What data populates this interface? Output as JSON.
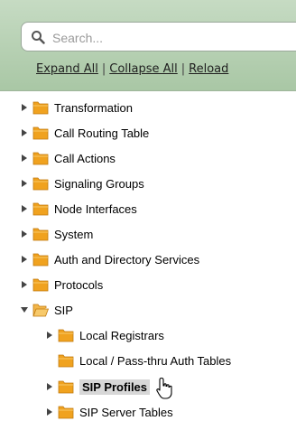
{
  "search": {
    "placeholder": "Search..."
  },
  "links": {
    "expand_all": "Expand All",
    "collapse_all": "Collapse All",
    "reload": "Reload",
    "separator": "|"
  },
  "tree": {
    "items": [
      {
        "label": "Transformation",
        "expanded": false
      },
      {
        "label": "Call Routing Table",
        "expanded": false
      },
      {
        "label": "Call Actions",
        "expanded": false
      },
      {
        "label": "Signaling Groups",
        "expanded": false
      },
      {
        "label": "Node Interfaces",
        "expanded": false
      },
      {
        "label": "System",
        "expanded": false
      },
      {
        "label": "Auth and Directory Services",
        "expanded": false
      },
      {
        "label": "Protocols",
        "expanded": false
      },
      {
        "label": "SIP",
        "expanded": true,
        "children": [
          {
            "label": "Local Registrars",
            "expanded": false
          },
          {
            "label": "Local / Pass-thru Auth Tables",
            "leaf": true
          },
          {
            "label": "SIP Profiles",
            "selected": true,
            "expanded": false
          },
          {
            "label": "SIP Server Tables",
            "expanded": false,
            "partially_visible": true
          }
        ]
      }
    ]
  },
  "colors": {
    "header_bg": "#b5d1b1",
    "folder": "#f0a21f",
    "selected_bg": "#d7d7d7"
  },
  "icons": [
    "search-icon",
    "expand-arrow-icon",
    "collapse-arrow-icon",
    "folder-icon",
    "open-folder-icon",
    "hand-pointer-icon"
  ]
}
